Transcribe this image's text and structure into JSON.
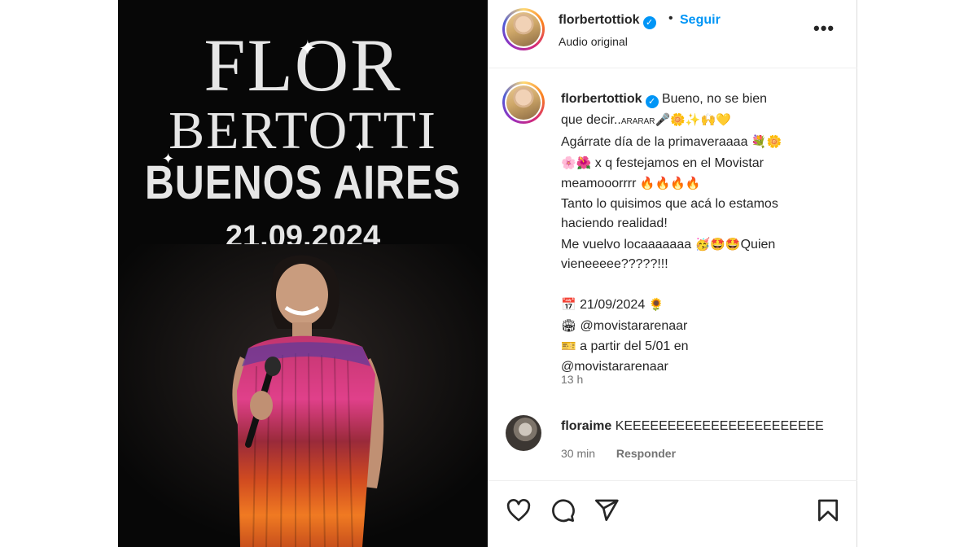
{
  "poster": {
    "line1": "FLOR",
    "line2": "BERTOTTI",
    "line3": "BUENOS AIRES",
    "date": "21.09.2024"
  },
  "header": {
    "username": "florbertottiok",
    "verified_mark": "✓",
    "separator": "•",
    "follow_label": "Seguir",
    "audio_label": "Audio original",
    "more_label": "•••"
  },
  "caption": {
    "username": "florbertottiok",
    "verified_mark": "✓",
    "l1": "Bueno, no se bien",
    "l2a": "que decir..",
    "l2b": "ARARAR",
    "l2c": "🎤🌼✨🙌💛",
    "l3a": "Agárrate día de la primaveraaaa ",
    "l3b": "💐🌼",
    "l4a": "🌸🌺",
    "l4b": " x q festejamos en el Movistar",
    "l5a": "meamooorrrr ",
    "l5b": "🔥🔥🔥🔥",
    "l6": "Tanto lo quisimos que acá lo estamos",
    "l7": "haciendo realidad!",
    "l8a": "Me vuelvo locaaaaaaa ",
    "l8b": "🥳🤩🤩",
    "l8c": "Quien",
    "l9": "vieneeeee?????!!!",
    "l10a": "📅",
    "l10b": " 21/09/2024 ",
    "l10c": "🌻",
    "l11a": "🏟",
    "l11b": " @movistararenaar",
    "l12a": "🎫",
    "l12b": " a partir del 5/01 en",
    "l13": "@movistararenaar",
    "time": "13 h"
  },
  "comment": {
    "username": "floraime",
    "text": "KEEEEEEEEEEEEEEEEEEEEEEE",
    "time": "30 min",
    "reply_label": "Responder"
  },
  "actions": {
    "like_icon": "heart-icon",
    "comment_icon": "comment-icon",
    "share_icon": "send-icon",
    "save_icon": "bookmark-icon"
  },
  "colors": {
    "accent": "#0095f6",
    "media_bg": "#070707",
    "muted": "#737373"
  }
}
